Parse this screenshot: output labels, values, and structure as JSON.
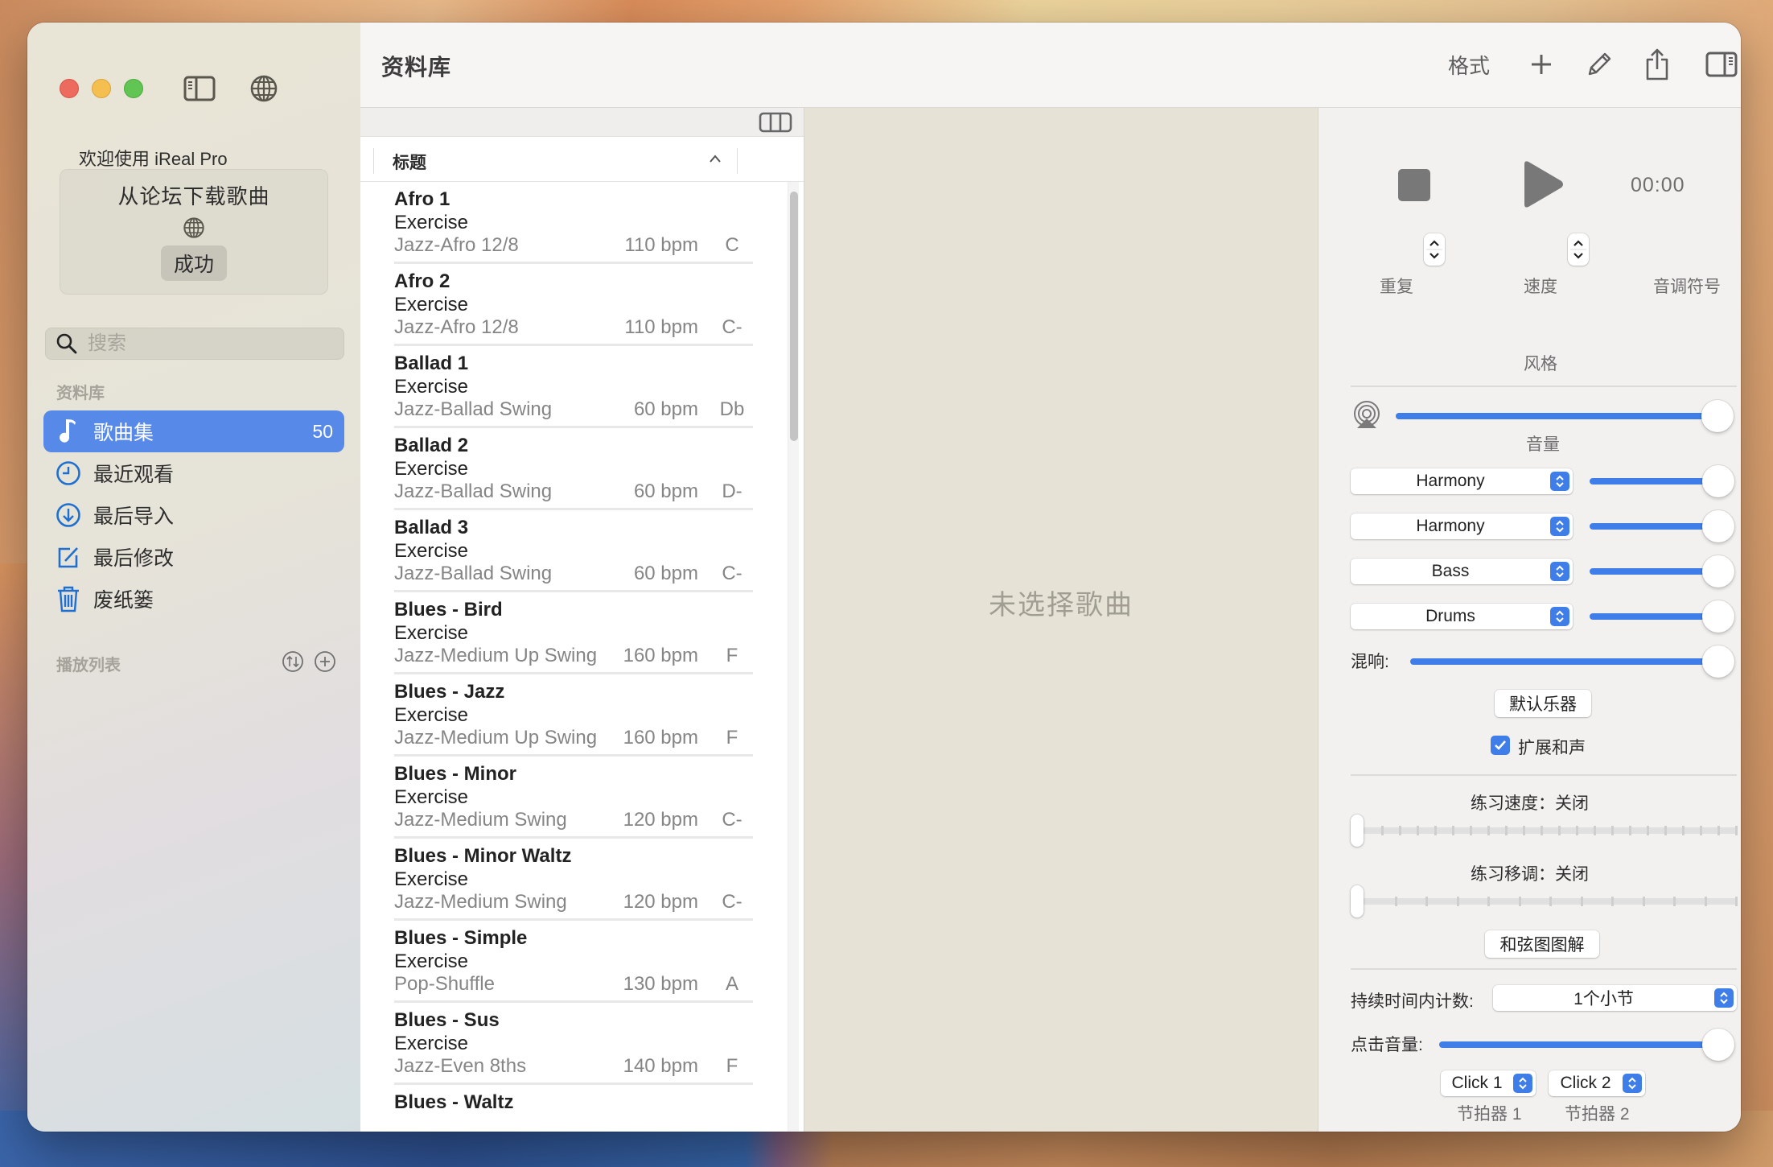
{
  "window": {
    "traffic_lights": [
      "close",
      "minimize",
      "zoom"
    ],
    "icons": {
      "sidebar_toggle": "sidebar-left-icon",
      "globe": "globe-icon"
    }
  },
  "sidebar": {
    "welcome": "欢迎使用 iReal Pro",
    "forum_box": {
      "title": "从论坛下载歌曲",
      "icon": "globe-icon",
      "status": "成功"
    },
    "search": {
      "placeholder": "搜索",
      "value": ""
    },
    "library_section": "资料库",
    "items": [
      {
        "label": "歌曲集",
        "icon": "music-note-icon",
        "count": "50",
        "active": true
      },
      {
        "label": "最近观看",
        "icon": "clock-icon",
        "active": false
      },
      {
        "label": "最后导入",
        "icon": "arrow-down-circle-icon",
        "active": false
      },
      {
        "label": "最后修改",
        "icon": "edit-square-icon",
        "active": false
      },
      {
        "label": "废纸篓",
        "icon": "trash-icon",
        "active": false
      }
    ],
    "playlists_section": "播放列表",
    "playlist_buttons": [
      "sort-icon",
      "add-circle-icon"
    ]
  },
  "toolbar": {
    "title": "资料库",
    "format_label": "格式",
    "buttons": [
      "plus-icon",
      "pencil-icon",
      "share-icon",
      "sidebar-right-icon"
    ]
  },
  "song_list": {
    "column_header": "标题",
    "sort": "ascending",
    "songs": [
      {
        "title": "Afro 1",
        "composer": "Exercise",
        "style": "Jazz-Afro 12/8",
        "bpm": "110 bpm",
        "key": "C"
      },
      {
        "title": "Afro 2",
        "composer": "Exercise",
        "style": "Jazz-Afro 12/8",
        "bpm": "110 bpm",
        "key": "C-"
      },
      {
        "title": "Ballad 1",
        "composer": "Exercise",
        "style": "Jazz-Ballad Swing",
        "bpm": "60 bpm",
        "key": "Db"
      },
      {
        "title": "Ballad 2",
        "composer": "Exercise",
        "style": "Jazz-Ballad Swing",
        "bpm": "60 bpm",
        "key": "D-"
      },
      {
        "title": "Ballad 3",
        "composer": "Exercise",
        "style": "Jazz-Ballad Swing",
        "bpm": "60 bpm",
        "key": "C-"
      },
      {
        "title": "Blues - Bird",
        "composer": "Exercise",
        "style": "Jazz-Medium Up Swing",
        "bpm": "160 bpm",
        "key": "F"
      },
      {
        "title": "Blues - Jazz",
        "composer": "Exercise",
        "style": "Jazz-Medium Up Swing",
        "bpm": "160 bpm",
        "key": "F"
      },
      {
        "title": "Blues - Minor",
        "composer": "Exercise",
        "style": "Jazz-Medium Swing",
        "bpm": "120 bpm",
        "key": "C-"
      },
      {
        "title": "Blues - Minor Waltz",
        "composer": "Exercise",
        "style": "Jazz-Medium Swing",
        "bpm": "120 bpm",
        "key": "C-"
      },
      {
        "title": "Blues - Simple",
        "composer": "Exercise",
        "style": "Pop-Shuffle",
        "bpm": "130 bpm",
        "key": "A"
      },
      {
        "title": "Blues - Sus",
        "composer": "Exercise",
        "style": "Jazz-Even 8ths",
        "bpm": "140 bpm",
        "key": "F"
      },
      {
        "title": "Blues - Waltz",
        "composer": "",
        "style": "",
        "bpm": "",
        "key": ""
      }
    ]
  },
  "center": {
    "empty_message": "未选择歌曲"
  },
  "player": {
    "time": "00:00",
    "repeat_label": "重复",
    "tempo_label": "速度",
    "key_label": "音调符号",
    "style_label": "风格",
    "volume_label": "音量",
    "master_volume": 1.0,
    "instruments": [
      {
        "name": "Harmony",
        "volume": 1.0
      },
      {
        "name": "Harmony",
        "volume": 1.0
      },
      {
        "name": "Bass",
        "volume": 1.0
      },
      {
        "name": "Drums",
        "volume": 1.0
      }
    ],
    "reverb_label": "混响:",
    "reverb": 1.0,
    "default_instruments_button": "默认乐器",
    "extended_harmony": {
      "label": "扩展和声",
      "checked": true
    },
    "practice_tempo": {
      "label": "练习速度：",
      "value": "关闭",
      "position": 0
    },
    "practice_transpose": {
      "label": "练习移调：",
      "value": "关闭",
      "position": 0
    },
    "chord_diagrams_button": "和弦图图解",
    "count_in": {
      "label": "持续时间内计数:",
      "value": "1个小节"
    },
    "click_volume": {
      "label": "点击音量:",
      "value": 1.0
    },
    "metronomes": [
      {
        "sound": "Click 1",
        "label": "节拍器 1"
      },
      {
        "sound": "Click 2",
        "label": "节拍器 2"
      }
    ]
  },
  "colors": {
    "accent": "#3f7ee8",
    "sidebar_selection": "#5789e8"
  }
}
